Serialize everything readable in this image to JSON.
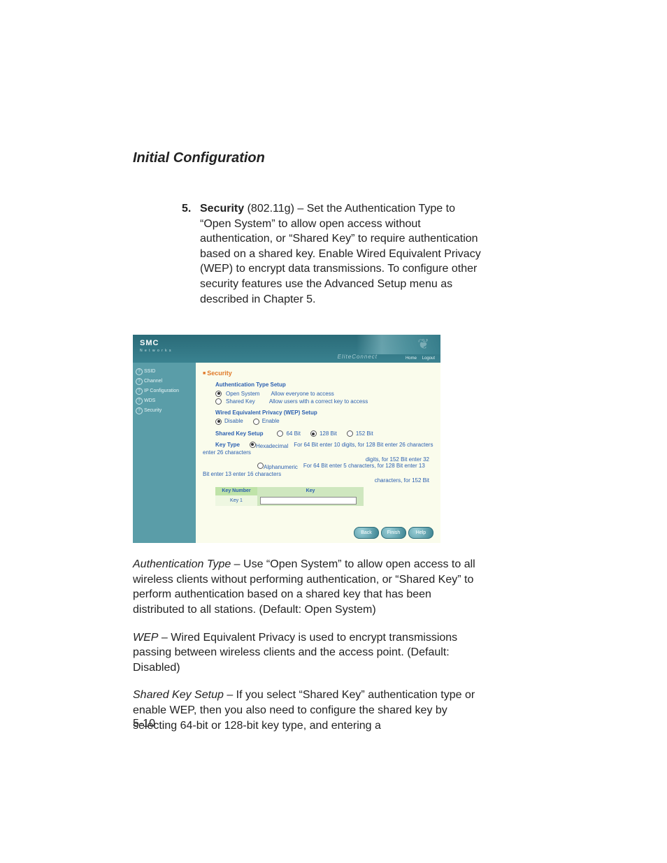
{
  "doc": {
    "page_title": "Initial Configuration",
    "page_number": "5-10",
    "step": {
      "marker": "5.",
      "term": "Security",
      "proto": " (802.11g) – ",
      "body": "Set the Authentication Type to “Open System” to allow open access without authentication, or “Shared Key” to require authentication based on a shared key. Enable Wired Equivalent Privacy (WEP) to encrypt data transmissions. To configure other security features use the Advanced Setup menu as described in Chapter 5."
    },
    "auth_para": {
      "term": "Authentication Type",
      "body": " – Use “Open System” to allow open access to all wireless clients without performing authentication, or “Shared Key” to perform authentication based on a shared key that has been distributed to all stations. (Default: Open System)"
    },
    "wep_para": {
      "term": "WEP",
      "body": " – Wired Equivalent Privacy is used to encrypt transmissions passing between wireless clients and the access point. (Default: Disabled)"
    },
    "shared_para": {
      "term": "Shared Key Setup",
      "body": " – If you select “Shared Key” authentication type or enable WEP, then you also need to configure the shared key by selecting 64-bit or 128-bit key type, and entering a"
    }
  },
  "shot": {
    "brand": "SMC",
    "brand_sub": "N e t w o r k s",
    "product": "EliteConnect",
    "toplinks": {
      "home": "Home",
      "logout": "Logout"
    },
    "nav": [
      "SSID",
      "Channel",
      "IP Configuration",
      "WDS",
      "Security"
    ],
    "title": "Security",
    "auth_section": "Authentication Type Setup",
    "auth": {
      "open": {
        "label": "Open System",
        "desc": "Allow everyone to access",
        "checked": true
      },
      "shared": {
        "label": "Shared Key",
        "desc": "Allow users with a correct key to access",
        "checked": false
      }
    },
    "wep_section": "Wired Equivalent Privacy (WEP) Setup",
    "wep": {
      "disable": {
        "label": "Disable",
        "checked": true
      },
      "enable": {
        "label": "Enable",
        "checked": false
      }
    },
    "sks_section": "Shared Key Setup",
    "sks": {
      "b64": {
        "label": "64 Bit",
        "checked": false
      },
      "b128": {
        "label": "128 Bit",
        "checked": true
      },
      "b152": {
        "label": "152 Bit",
        "checked": false
      }
    },
    "keytype_label": "Key Type",
    "keytype": {
      "hex": {
        "label": "Hexadecimal",
        "checked": true,
        "hint": "For 64 Bit enter 10 digits, for 128 Bit enter 26 characters",
        "hint2": "digits, for 152 Bit enter 32"
      },
      "alpha": {
        "label": "Alphanumeric",
        "checked": false,
        "hint": "For 64 Bit enter 5 characters, for 128 Bit enter 13",
        "hint2": "characters, for 152 Bit enter 16 characters"
      }
    },
    "left_hint1": "enter 26 characters",
    "left_hint2": "Bit enter 13 enter 16 characters",
    "table": {
      "col1": "Key Number",
      "col2": "Key",
      "row1": "Key 1",
      "value": ""
    },
    "buttons": {
      "back": "Back",
      "finish": "Finish",
      "help": "Help"
    }
  }
}
